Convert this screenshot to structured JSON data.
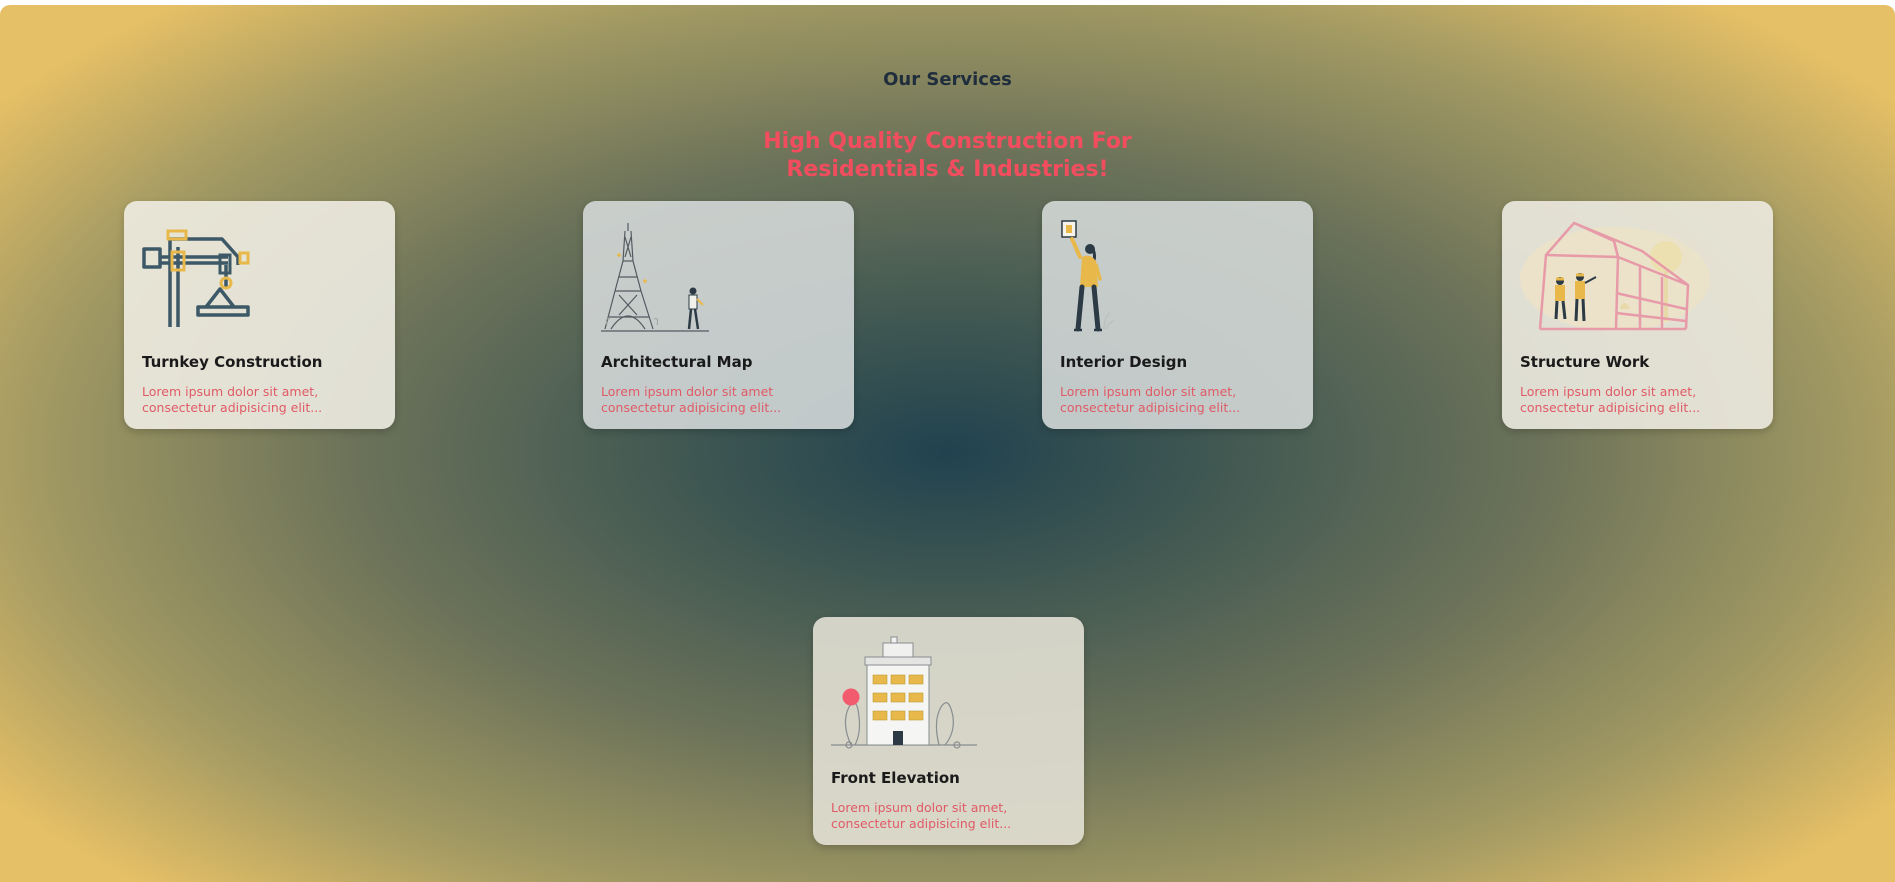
{
  "section": {
    "label": "Our Services",
    "headline_line1": "High Quality Construction For",
    "headline_line2": "Residentials & Industries!"
  },
  "services": [
    {
      "title": "Turnkey Construction",
      "desc_line1": "Lorem ipsum dolor sit amet,",
      "desc_line2": "consectetur adipisicing elit...",
      "icon": "crane-icon"
    },
    {
      "title": "Architectural Map",
      "desc_line1": "Lorem ipsum dolor sit amet",
      "desc_line2": "consectetur adipisicing elit...",
      "icon": "eiffel-tower-icon"
    },
    {
      "title": "Interior Design",
      "desc_line1": "Lorem ipsum dolor sit amet,",
      "desc_line2": "consectetur adipisicing elit...",
      "icon": "woman-hanging-picture-icon"
    },
    {
      "title": "Structure Work",
      "desc_line1": "Lorem ipsum dolor sit amet,",
      "desc_line2": "consectetur adipisicing elit...",
      "icon": "house-frame-workers-icon"
    },
    {
      "title": "Front Elevation",
      "desc_line1": "Lorem ipsum dolor sit amet,",
      "desc_line2": "consectetur adipisicing elit...",
      "icon": "building-icon"
    }
  ],
  "colors": {
    "accent_red": "#f24d5e",
    "accent_yellow": "#e8b84a",
    "dark_blue": "#2f4a5a",
    "gradient_center": "#21424f",
    "gradient_edge": "#e6c066"
  }
}
